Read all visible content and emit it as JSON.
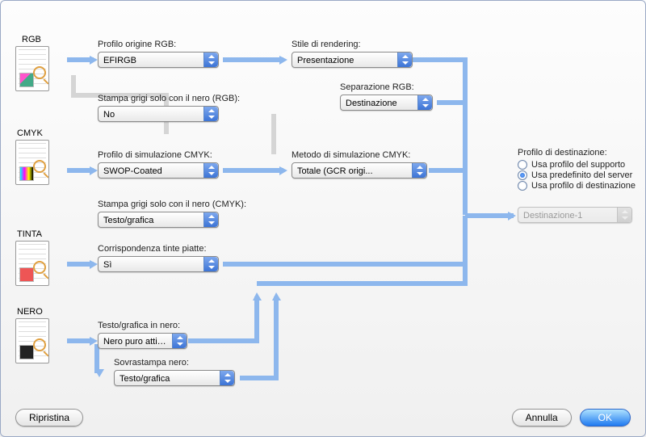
{
  "sections": {
    "rgb": "RGB",
    "cmyk": "CMYK",
    "tinta": "TINTA",
    "nero": "NERO"
  },
  "rgb": {
    "source_label": "Profilo origine RGB:",
    "source_value": "EFIRGB",
    "black_label": "Stampa grigi solo con il nero (RGB):",
    "black_value": "No",
    "rendering_label": "Stile di rendering:",
    "rendering_value": "Presentazione",
    "separation_label": "Separazione RGB:",
    "separation_value": "Destinazione"
  },
  "cmyk": {
    "sim_profile_label": "Profilo di simulazione CMYK:",
    "sim_profile_value": "SWOP-Coated",
    "sim_method_label": "Metodo di simulazione CMYK:",
    "sim_method_value": "Totale (GCR origi...",
    "black_label": "Stampa grigi solo con il nero (CMYK):",
    "black_value": "Testo/grafica"
  },
  "spot": {
    "match_label": "Corrispondenza tinte piatte:",
    "match_value": "Sì"
  },
  "black": {
    "textgfx_label": "Testo/grafica in nero:",
    "textgfx_value": "Nero puro attivato",
    "overprint_label": "Sovrastampa nero:",
    "overprint_value": "Testo/grafica"
  },
  "output": {
    "profile_label": "Profilo di destinazione:",
    "opt_media": "Usa profilo del supporto",
    "opt_server": "Usa predefinito del server",
    "opt_dest": "Usa profilo di destinazione",
    "dest_value": "Destinazione-1",
    "selected": "opt_server"
  },
  "buttons": {
    "reset": "Ripristina",
    "cancel": "Annulla",
    "ok": "OK"
  },
  "colors": {
    "wire": "#8db7ed",
    "wire_dim": "#d5d5d5"
  }
}
